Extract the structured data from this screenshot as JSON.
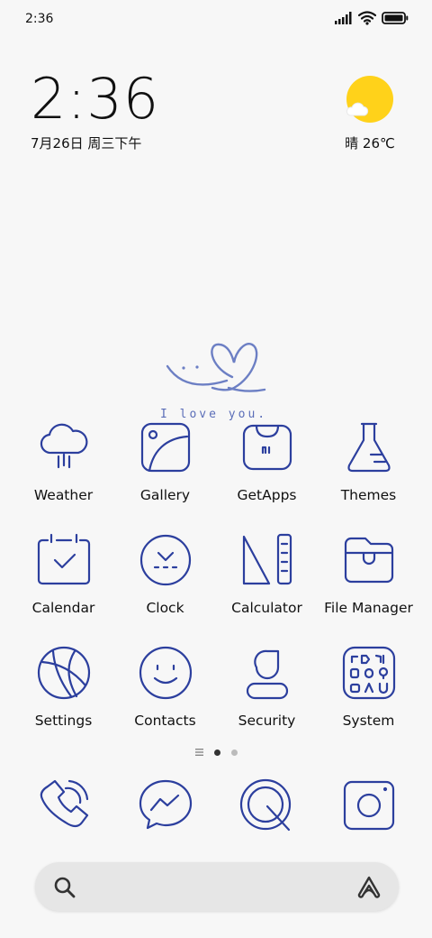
{
  "status_bar": {
    "time": "2:36"
  },
  "clock_widget": {
    "time": "2:36",
    "date": "7月26日 周三下午"
  },
  "weather_widget": {
    "condition": "晴",
    "temperature": "26℃"
  },
  "decoration": {
    "text": "I love you."
  },
  "apps": [
    {
      "label": "Weather",
      "icon": "cloud-rain-icon"
    },
    {
      "label": "Gallery",
      "icon": "gallery-icon"
    },
    {
      "label": "GetApps",
      "icon": "shopping-bag-icon"
    },
    {
      "label": "Themes",
      "icon": "flask-icon"
    },
    {
      "label": "Calendar",
      "icon": "calendar-icon"
    },
    {
      "label": "Clock",
      "icon": "clock-icon"
    },
    {
      "label": "Calculator",
      "icon": "calculator-icon"
    },
    {
      "label": "File Manager",
      "icon": "folder-icon"
    },
    {
      "label": "Settings",
      "icon": "settings-icon"
    },
    {
      "label": "Contacts",
      "icon": "smiley-icon"
    },
    {
      "label": "Security",
      "icon": "security-icon"
    },
    {
      "label": "System",
      "icon": "system-folder-icon"
    }
  ],
  "page_indicator": {
    "pages": 2,
    "active_page": 1
  },
  "dock": [
    {
      "icon": "phone-icon"
    },
    {
      "icon": "messenger-icon"
    },
    {
      "icon": "browser-icon"
    },
    {
      "icon": "camera-icon"
    }
  ],
  "search_bar": {
    "left_icon": "search-icon",
    "right_icon": "assistant-icon"
  },
  "colors": {
    "icon_stroke": "#2c3f9e",
    "sun": "#ffd21a",
    "background": "#f7f7f7"
  }
}
